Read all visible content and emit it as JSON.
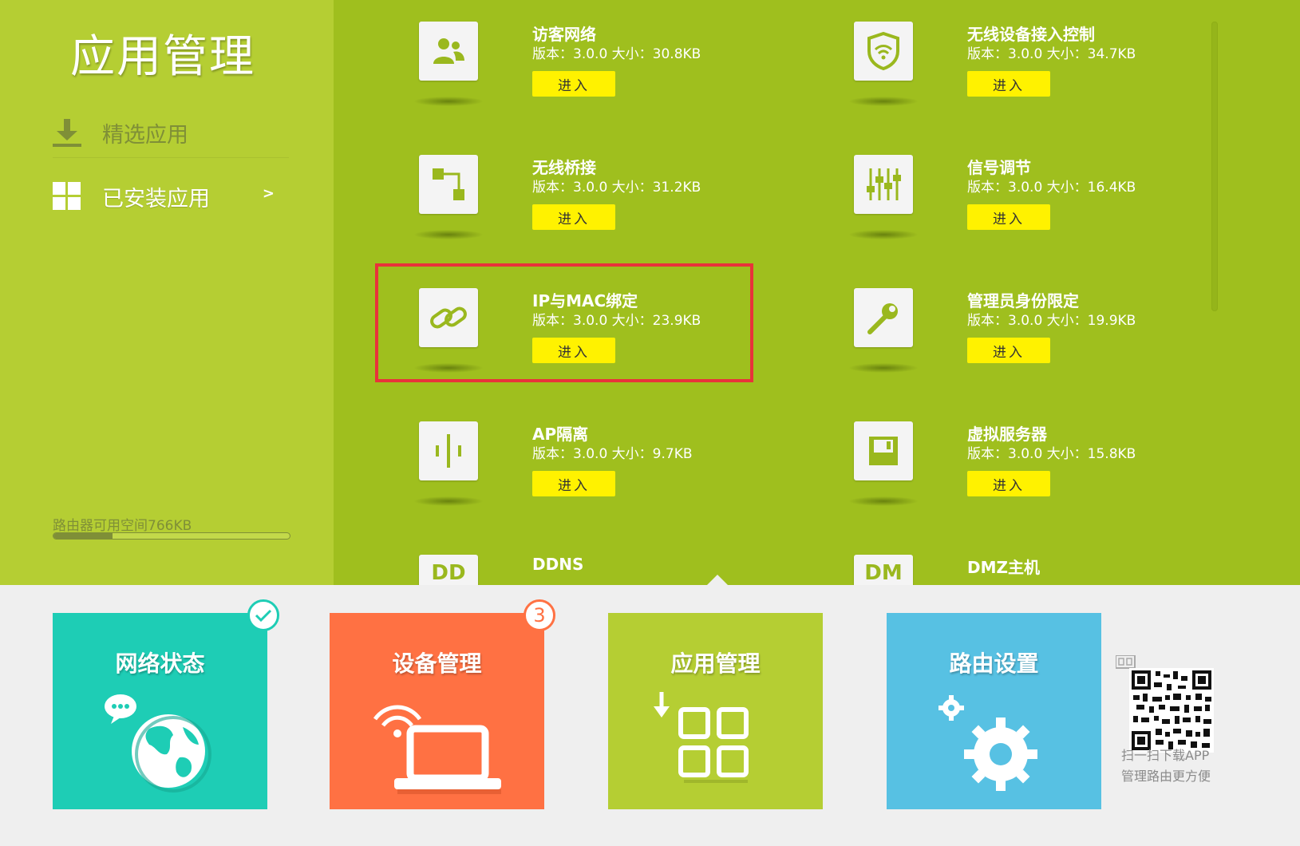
{
  "sidebar": {
    "title": "应用管理",
    "nav": [
      {
        "label": "精选应用",
        "icon": "download-icon"
      },
      {
        "label": "已安装应用",
        "icon": "grid-icon",
        "chevron": ">"
      }
    ],
    "storage": {
      "text": "路由器可用空间766KB",
      "used_fraction": 0.25
    }
  },
  "apps": [
    {
      "name": "访客网络",
      "meta": "版本：3.0.0 大小：30.8KB",
      "enter": "进入",
      "icon": "guest-users-icon"
    },
    {
      "name": "无线设备接入控制",
      "meta": "版本：3.0.0 大小：34.7KB",
      "enter": "进入",
      "icon": "wifi-shield-icon"
    },
    {
      "name": "无线桥接",
      "meta": "版本：3.0.0 大小：31.2KB",
      "enter": "进入",
      "icon": "bridge-icon"
    },
    {
      "name": "信号调节",
      "meta": "版本：3.0.0 大小：16.4KB",
      "enter": "进入",
      "icon": "sliders-icon"
    },
    {
      "name": "IP与MAC绑定",
      "meta": "版本：3.0.0 大小：23.9KB",
      "enter": "进入",
      "icon": "link-icon",
      "highlighted": true
    },
    {
      "name": "管理员身份限定",
      "meta": "版本：3.0.0 大小：19.9KB",
      "enter": "进入",
      "icon": "wrench-icon"
    },
    {
      "name": "AP隔离",
      "meta": "版本：3.0.0 大小：9.7KB",
      "enter": "进入",
      "icon": "ap-isolation-icon"
    },
    {
      "name": "虚拟服务器",
      "meta": "版本：3.0.0 大小：15.8KB",
      "enter": "进入",
      "icon": "floppy-icon"
    },
    {
      "name": "DDNS",
      "meta": "",
      "enter": "",
      "icon": "ddns-icon",
      "icon_text": "DD"
    },
    {
      "name": "DMZ主机",
      "meta": "",
      "enter": "",
      "icon": "dmz-icon",
      "icon_text": "DM"
    }
  ],
  "tiles": [
    {
      "label": "网络状态",
      "color": "#1ecdb5",
      "badge_icon": "check-icon",
      "graphic": "globe-icon"
    },
    {
      "label": "设备管理",
      "color": "#ff7143",
      "badge": "3",
      "graphic": "laptop-icon"
    },
    {
      "label": "应用管理",
      "color": "#b5ce33",
      "graphic": "apps-icon"
    },
    {
      "label": "路由设置",
      "color": "#57c1e3",
      "graphic": "gears-icon"
    }
  ],
  "qr": {
    "line1": "扫一扫下载APP",
    "line2": "管理路由更方便"
  },
  "colors": {
    "sidebar": "#b5ce33",
    "main": "#9fbf1e",
    "enter_button": "#fff200",
    "highlight": "#e8333a"
  }
}
